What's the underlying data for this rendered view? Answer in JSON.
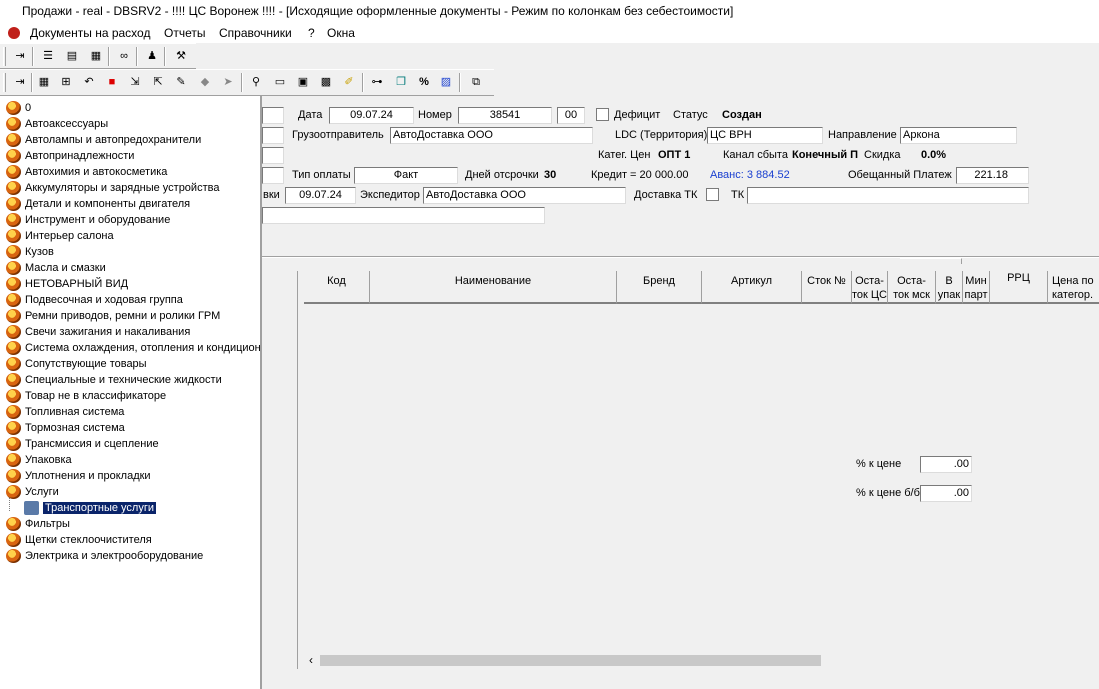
{
  "window": {
    "title": "Продажи - real - DBSRV2 -     !!!! ЦС Воронеж  !!!! - [Исходящие оформленные документы - Режим по колонкам без себестоимости]"
  },
  "menu": [
    "Документы на расход",
    "Отчеты",
    "Справочники",
    "?",
    "Окна"
  ],
  "toolbar1": {
    "icons": [
      "exit-icon",
      "list-icon",
      "form-icon",
      "report-icon",
      "binoculars-icon",
      "users-icon",
      "tools-icon"
    ]
  },
  "toolbar2": {
    "icons": [
      "exit-icon",
      "grid-icon",
      "tree-icon",
      "undo-icon",
      "red-stop-icon",
      "export-icon",
      "import-icon",
      "edit-icon",
      "box-icon",
      "arrow-icon",
      "search-icon",
      "document-icon",
      "save-icon",
      "save-all-icon",
      "marker-icon",
      "link-icon",
      "copy-icon",
      "percent-icon",
      "chart-icon",
      "windows-icon"
    ]
  },
  "tree": {
    "items": [
      "0",
      "Автоаксессуары",
      "Автолампы и автопредохранители",
      "Автопринадлежности",
      "Автохимия и автокосметика",
      "Аккумуляторы и зарядные устройства",
      "Детали и компоненты двигателя",
      "Инструмент и оборудование",
      "Интерьер салона",
      "Кузов",
      "Масла и смазки",
      "НЕТОВАРНЫЙ ВИД",
      "Подвесочная и ходовая группа",
      "Ремни приводов, ремни и ролики ГРМ",
      "Свечи зажигания и накаливания",
      "Система охлаждения, отопления и кондицион",
      "Сопутствующие товары",
      "Специальные и технические жидкости",
      "Товар не в классификаторе",
      "Топливная система",
      "Тормозная система",
      "Трансмиссия и сцепление",
      "Упаковка",
      "Уплотнения и прокладки",
      "Услуги"
    ],
    "selected": "Транспортные услуги",
    "after": [
      "Фильтры",
      "Щетки стеклоочистителя",
      "Электрика и электрооборудование"
    ]
  },
  "form": {
    "date_label": "Дата",
    "date_value": "09.07.24",
    "number_label": "Номер",
    "number_value": "38541",
    "suffix_value": "00",
    "deficit_label": "Дефицит",
    "status_label": "Статус",
    "status_value": "Создан",
    "shipper_label": "Грузоотправитель",
    "shipper_value": "АвтоДоставка ООО",
    "ldc_label": "LDC (Территория)",
    "ldc_value": "ЦС ВРН",
    "direction_label": "Направление",
    "direction_value": "Аркона",
    "price_cat_label": "Катег. Цен",
    "price_cat_value": "ОПТ 1",
    "channel_label": "Канал сбыта",
    "channel_value": "Конечный П",
    "discount_label": "Скидка",
    "discount_value": "0.0%",
    "payment_label": "Тип оплаты",
    "payment_value": "Факт",
    "delay_label": "Дней отсрочки",
    "delay_value": "30",
    "credit_text": "Кредит = 20 000.00",
    "advance_text": "Аванс: 3 884.52",
    "promised_label": "Обещанный Платеж",
    "promised_value": "221.18",
    "ship_date_label": "вки",
    "ship_date_value": "09.07.24",
    "forwarder_label": "Экспедитор",
    "forwarder_value": "АвтоДоставка ООО",
    "tk_delivery_label": "Доставка ТК",
    "tk_label": "ТК",
    "tk_value": ""
  },
  "grid": {
    "columns": [
      "Код",
      "Наименование",
      "Бренд",
      "Артикул",
      "Сток №",
      "Оста-\nток ЦС",
      "Оста-\nток мск",
      "В\nупак",
      "Мин\nпарт",
      "РРЦ",
      "Цена по\nкатегор."
    ]
  },
  "percent": {
    "price_label": "% к цене",
    "price_value": ".00",
    "price_bb_label": "% к цене б/б",
    "price_bb_value": ".00"
  },
  "colors": {
    "selection": "#0a246a",
    "advance": "#1a3fd0",
    "background": "#f0f0f0"
  }
}
